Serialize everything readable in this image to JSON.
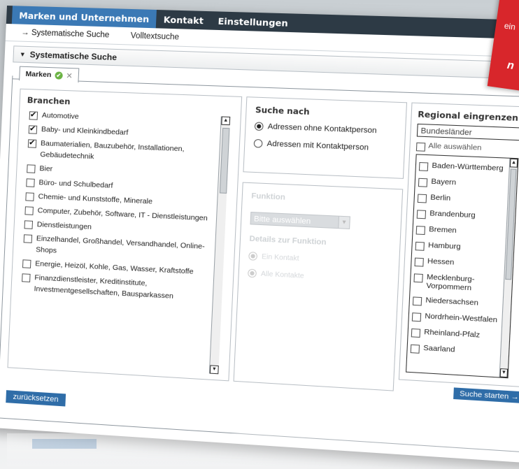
{
  "topnav": {
    "tabs": [
      {
        "label": "Marken und Unternehmen",
        "active": true
      },
      {
        "label": "Kontakt",
        "active": false
      },
      {
        "label": "Einstellungen",
        "active": false
      }
    ]
  },
  "subnav": {
    "systematic": "→ Systematische Suche",
    "fulltext": "Volltextsuche"
  },
  "section": {
    "title": "Systematische Suche"
  },
  "tab": {
    "label": "Marken"
  },
  "branchen": {
    "title": "Branchen",
    "items": [
      {
        "label": "Automotive",
        "checked": true
      },
      {
        "label": "Baby- und Kleinkindbedarf",
        "checked": true
      },
      {
        "label": "Baumaterialien, Bauzubehör, Installationen, Gebäudetechnik",
        "checked": true
      },
      {
        "label": "Bier",
        "checked": false
      },
      {
        "label": "Büro- und Schulbedarf",
        "checked": false
      },
      {
        "label": "Chemie- und Kunststoffe, Minerale",
        "checked": false
      },
      {
        "label": "Computer, Zubehör, Software, IT - Dienstleistungen",
        "checked": false
      },
      {
        "label": "Dienstleistungen",
        "checked": false
      },
      {
        "label": "Einzelhandel, Großhandel, Versandhandel, Online-Shops",
        "checked": false
      },
      {
        "label": "Energie, Heizöl, Kohle, Gas, Wasser, Kraftstoffe",
        "checked": false
      },
      {
        "label": "Finanzdienstleister, Kreditinstitute, Investmentgesellschaften, Bausparkassen",
        "checked": false
      }
    ]
  },
  "suche": {
    "title": "Suche nach",
    "options": [
      {
        "label": "Adressen ohne Kontaktperson",
        "selected": true
      },
      {
        "label": "Adressen mit Kontaktperson",
        "selected": false
      }
    ]
  },
  "funktion": {
    "title": "Funktion",
    "select_value": "Bitte auswählen",
    "details_title": "Details zur Funktion",
    "options": [
      {
        "label": "Ein Kontakt",
        "selected": true
      },
      {
        "label": "Alle Kontakte",
        "selected": false
      }
    ]
  },
  "regional": {
    "title": "Regional eingrenzen",
    "select_value": "Bundesländer",
    "select_all": "Alle auswählen",
    "states": [
      "Baden-Württemberg",
      "Bayern",
      "Berlin",
      "Brandenburg",
      "Bremen",
      "Hamburg",
      "Hessen",
      "Mecklenburg-Vorpommern",
      "Niedersachsen",
      "Nordrhein-Westfalen",
      "Rheinland-Pfalz",
      "Saarland"
    ]
  },
  "buttons": {
    "start": "Suche starten  →",
    "reset": "zurücksetzen"
  },
  "promo": {
    "line1": "ein",
    "line2": "n"
  },
  "colors": {
    "nav_bg": "#2d3a45",
    "accent": "#3b79b5",
    "button": "#2f6da8",
    "promo": "#d8262b"
  }
}
